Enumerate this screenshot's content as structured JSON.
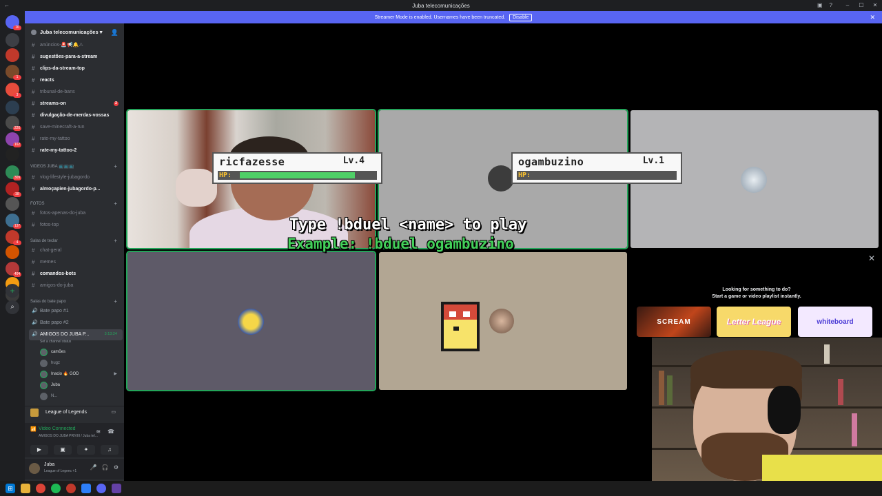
{
  "window": {
    "title": "Juba telecomunicações"
  },
  "banner": {
    "text": "Streamer Mode is enabled. Usernames have been truncated.",
    "button": "Disable"
  },
  "server_list": {
    "badges": [
      "16",
      "1",
      "3",
      "220",
      "162",
      "309",
      "38",
      "137",
      "4",
      "404"
    ]
  },
  "guild": {
    "name": "Juba telecomunicações"
  },
  "channels": [
    {
      "name": "anúncios-🚨📢🔔⚠",
      "bright": false,
      "badge": ""
    },
    {
      "name": "sugestões-para-a-stream",
      "bright": true,
      "badge": ""
    },
    {
      "name": "clips-da-stream-top",
      "bright": true,
      "badge": ""
    },
    {
      "name": "reacts",
      "bright": true,
      "badge": ""
    },
    {
      "name": "tribunal-de-bans",
      "bright": false,
      "badge": ""
    },
    {
      "name": "streams-on",
      "bright": true,
      "badge": "2"
    },
    {
      "name": "divulgação-de-merdas-vossas",
      "bright": true,
      "badge": ""
    },
    {
      "name": "save-minecraft-a-run",
      "bright": false,
      "badge": ""
    },
    {
      "name": "rate-my-tattoo",
      "bright": false,
      "badge": ""
    },
    {
      "name": "rate-my-tattoo-2",
      "bright": true,
      "badge": ""
    }
  ],
  "categories": {
    "videos": "VIDEOS JUBA 📺📺📺",
    "fotos": "FOTOS",
    "teclar": "Salas de teclar",
    "bate_papo": "Salas do bate papo"
  },
  "videos_channels": [
    {
      "name": "vlog-lifestyle-jubagordo",
      "bright": false
    },
    {
      "name": "almoçapien-jubagordo-p...",
      "bright": true
    }
  ],
  "fotos_channels": [
    {
      "name": "fotos-apenas-do-juba",
      "bright": false
    },
    {
      "name": "fotos-top",
      "bright": false
    }
  ],
  "teclar_channels": [
    {
      "name": "chat-geral",
      "bright": false
    },
    {
      "name": "memes",
      "bright": false
    },
    {
      "name": "comandos-bots",
      "bright": true
    },
    {
      "name": "amigos-do-juba",
      "bright": false
    }
  ],
  "voice_channels": [
    {
      "name": "Bate papo #1"
    },
    {
      "name": "Bate papo #2"
    }
  ],
  "active_voice": {
    "name": "AMIGOS DO JUBA P...",
    "time": "3:13:24",
    "status": "Set a channel status",
    "users": [
      {
        "name": "camões",
        "dim": false
      },
      {
        "name": "hugz",
        "dim": true
      },
      {
        "name": "Inacio 🔥 GOD",
        "dim": false
      },
      {
        "name": "Juba",
        "dim": false
      },
      {
        "name": "N...",
        "dim": true
      }
    ]
  },
  "activity": {
    "name": "League of Legends"
  },
  "voice_panel": {
    "status": "Video Connected",
    "sub": "AMIGOS DO JUBA PRIVIII / Juba tel..."
  },
  "user_panel": {
    "name": "Juba",
    "status": "League of Legenc +1"
  },
  "game_overlay": {
    "player1": {
      "name": "ricfazesse",
      "level": "Lv.4",
      "hp_label": "HP:",
      "hp_fraction": 0.85
    },
    "player2": {
      "name": "ogambuzino",
      "level": "Lv.1",
      "hp_label": "HP:",
      "hp_fraction": 0.0
    },
    "line1": "Type !bduel <name> to play",
    "line2": "Example: !bduel ogambuzino"
  },
  "activities_panel": {
    "line1": "Looking for something to do?",
    "line2": "Start a game or video playlist instantly.",
    "cards": [
      "SCREAM",
      "Letter League",
      "whiteboard"
    ]
  },
  "colors": {
    "accent": "#5865f2",
    "speaking": "#23a55a",
    "hp_green": "#4fd067",
    "banner_bg": "#5865f2"
  }
}
